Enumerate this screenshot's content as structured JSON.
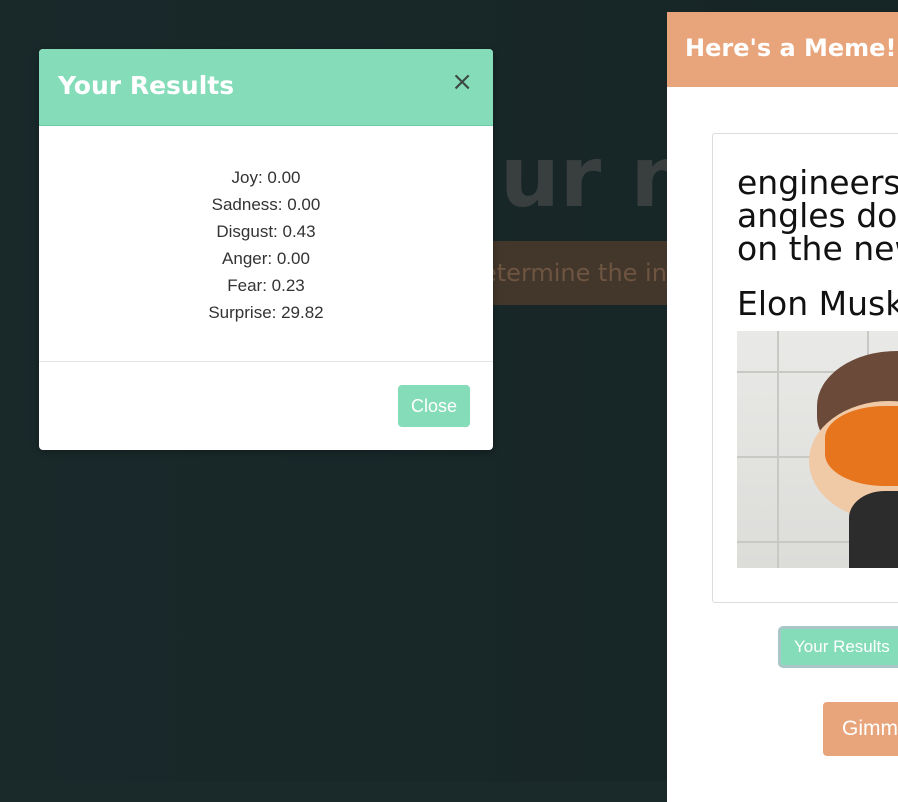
{
  "background": {
    "heading_fragment": "ur n",
    "cta_fragment": "etermine the in"
  },
  "results_modal": {
    "title": "Your Results",
    "close_symbol": "×",
    "emotions": [
      {
        "label": "Joy: 0.00"
      },
      {
        "label": "Sadness: 0.00"
      },
      {
        "label": "Disgust: 0.43"
      },
      {
        "label": "Anger: 0.00"
      },
      {
        "label": "Fear: 0.23"
      },
      {
        "label": "Surprise: 29.82"
      }
    ],
    "close_button": "Close"
  },
  "meme_modal": {
    "title": "Here's a Meme!",
    "caption_line1": "engineers:",
    "caption_line2": "angles do y",
    "caption_line3": "on the new",
    "caption_name": "Elon Musk",
    "results_button": "Your Results",
    "gimme_button": "Gimm"
  },
  "colors": {
    "accent_green": "#85dcb9",
    "accent_orange": "#e8a57b",
    "backdrop": "#1a2a2b"
  }
}
